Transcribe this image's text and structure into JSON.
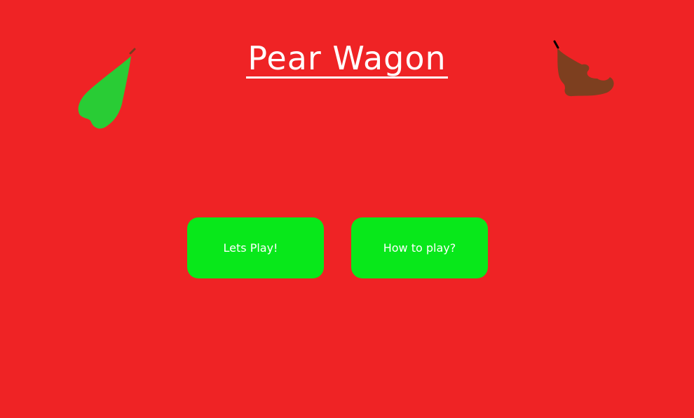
{
  "game": {
    "title": "Pear Wagon"
  },
  "menu": {
    "play_label": "Lets Play!",
    "howto_label": "How to play?"
  },
  "colors": {
    "background": "#ef2325",
    "button": "#08e81a",
    "pear_green": "#29cc35",
    "pear_brown": "#7d3f1f",
    "text": "#ffffff"
  },
  "icons": {
    "left": "green-pear-icon",
    "right": "bitten-brown-pear-icon"
  }
}
